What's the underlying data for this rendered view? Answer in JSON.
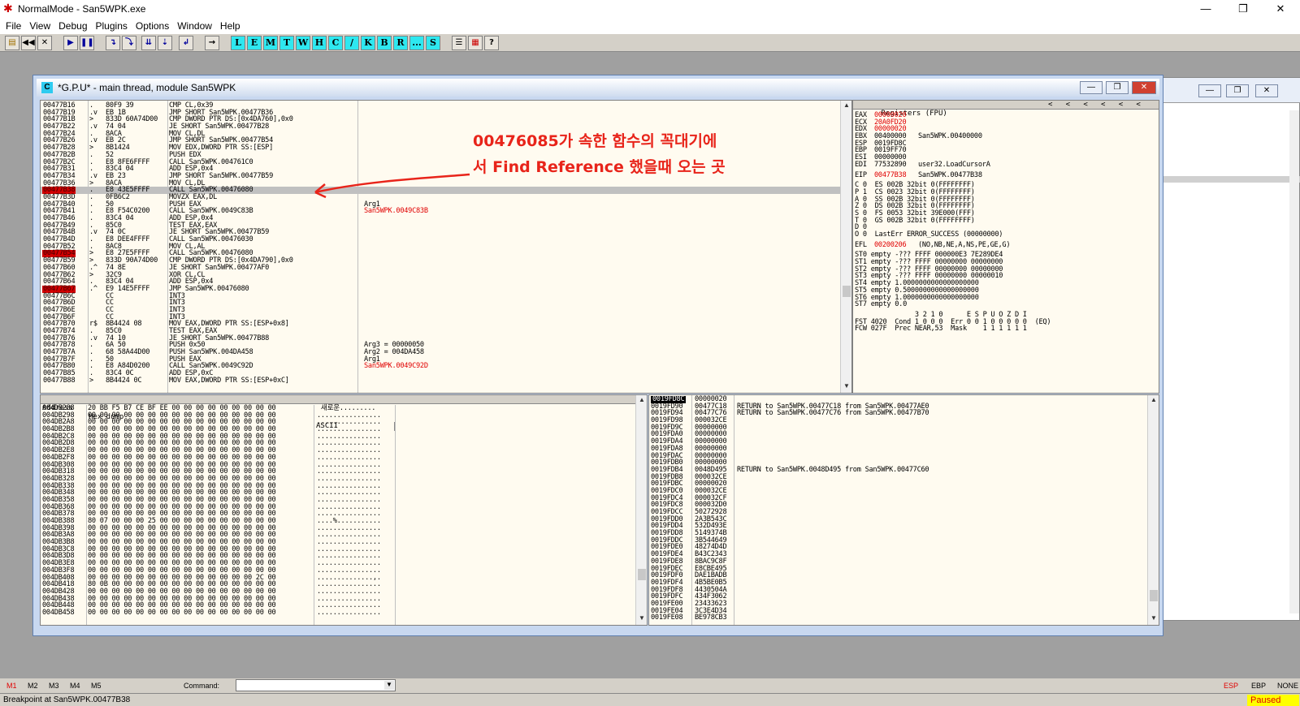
{
  "window": {
    "title": "NormalMode - San5WPK.exe",
    "minimize": "—",
    "maximize": "❐",
    "close": "✕"
  },
  "menu": [
    "File",
    "View",
    "Debug",
    "Plugins",
    "Options",
    "Window",
    "Help"
  ],
  "toolbar": {
    "tools": [
      "L",
      "E",
      "M",
      "T",
      "W",
      "H",
      "C",
      "/",
      "K",
      "B",
      "R",
      "...",
      "S"
    ]
  },
  "cpu": {
    "title": "*G.P.U* - main thread, module San5WPK"
  },
  "disasm": {
    "rows": [
      {
        "a": "00477B16",
        "m": ".",
        "h": "80F9 39",
        "i": "CMP CL,0x39",
        "c": ""
      },
      {
        "a": "00477B19",
        "m": ".v",
        "h": "EB 1B",
        "i": "JMP SHORT San5WPK.00477B36",
        "c": ""
      },
      {
        "a": "00477B1B",
        "m": ">",
        "h": "833D 60A74D00",
        "i": "CMP DWORD PTR DS:[0x4DA760],0x0",
        "c": ""
      },
      {
        "a": "00477B22",
        "m": ".v",
        "h": "74 04",
        "i": "JE SHORT San5WPK.00477B28",
        "c": ""
      },
      {
        "a": "00477B24",
        "m": ".",
        "h": "8ACA",
        "i": "MOV CL,DL",
        "c": ""
      },
      {
        "a": "00477B26",
        "m": ".v",
        "h": "EB 2C",
        "i": "JMP SHORT San5WPK.00477B54",
        "c": ""
      },
      {
        "a": "00477B28",
        "m": ">",
        "h": "8B1424",
        "i": "MOV EDX,DWORD PTR SS:[ESP]",
        "c": ""
      },
      {
        "a": "00477B2B",
        "m": ".",
        "h": "52",
        "i": "PUSH EDX",
        "c": ""
      },
      {
        "a": "00477B2C",
        "m": ".",
        "h": "E8 8FE6FFFF",
        "i": "CALL San5WPK.004761C0",
        "c": ""
      },
      {
        "a": "00477B31",
        "m": ".",
        "h": "83C4 04",
        "i": "ADD ESP,0x4",
        "c": ""
      },
      {
        "a": "00477B34",
        "m": ".v",
        "h": "EB 23",
        "i": "JMP SHORT San5WPK.00477B59",
        "c": ""
      },
      {
        "a": "00477B36",
        "m": ">",
        "h": "8ACA",
        "i": "MOV CL,DL",
        "c": ""
      },
      {
        "a": "00477B38",
        "m": ".",
        "h": "E8 43E5FFFF",
        "i": "CALL San5WPK.00476080",
        "c": "",
        "bp": true,
        "hl": true
      },
      {
        "a": "00477B3D",
        "m": ".",
        "h": "0FB6C2",
        "i": "MOVZX EAX,DL",
        "c": ""
      },
      {
        "a": "00477B40",
        "m": ".",
        "h": "50",
        "i": "PUSH EAX",
        "c": "Arg1"
      },
      {
        "a": "00477B41",
        "m": ".",
        "h": "E8 F54C0200",
        "i": "CALL San5WPK.0049C83B",
        "c": "San5WPK.0049C83B",
        "cr": true
      },
      {
        "a": "00477B46",
        "m": ".",
        "h": "83C4 04",
        "i": "ADD ESP,0x4",
        "c": ""
      },
      {
        "a": "00477B49",
        "m": ".",
        "h": "85C0",
        "i": "TEST EAX,EAX",
        "c": ""
      },
      {
        "a": "00477B4B",
        "m": ".v",
        "h": "74 0C",
        "i": "JE SHORT San5WPK.00477B59",
        "c": ""
      },
      {
        "a": "00477B4D",
        "m": ".",
        "h": "E8 DEE4FFFF",
        "i": "CALL San5WPK.00476030",
        "c": ""
      },
      {
        "a": "00477B52",
        "m": ".",
        "h": "8AC8",
        "i": "MOV CL,AL",
        "c": ""
      },
      {
        "a": "00477B54",
        "m": ">",
        "h": "E8 27E5FFFF",
        "i": "CALL San5WPK.00476080",
        "c": "",
        "bp": true
      },
      {
        "a": "00477B59",
        "m": ">",
        "h": "833D 90A74D00",
        "i": "CMP DWORD PTR DS:[0x4DA790],0x0",
        "c": ""
      },
      {
        "a": "00477B60",
        "m": ".^",
        "h": "74 8E",
        "i": "JE SHORT San5WPK.00477AF0",
        "c": ""
      },
      {
        "a": "00477B62",
        "m": ">",
        "h": "32C9",
        "i": "XOR CL,CL",
        "c": ""
      },
      {
        "a": "00477B64",
        "m": ".",
        "h": "83C4 04",
        "i": "ADD ESP,0x4",
        "c": ""
      },
      {
        "a": "00477B67",
        "m": ".^",
        "h": "E9 14E5FFFF",
        "i": "JMP San5WPK.00476080",
        "c": "",
        "bp": true
      },
      {
        "a": "00477B6C",
        "m": "",
        "h": "CC",
        "i": "INT3",
        "c": ""
      },
      {
        "a": "00477B6D",
        "m": "",
        "h": "CC",
        "i": "INT3",
        "c": ""
      },
      {
        "a": "00477B6E",
        "m": "",
        "h": "CC",
        "i": "INT3",
        "c": ""
      },
      {
        "a": "00477B6F",
        "m": "",
        "h": "CC",
        "i": "INT3",
        "c": ""
      },
      {
        "a": "00477B70",
        "m": "r$",
        "h": "8B4424 08",
        "i": "MOV EAX,DWORD PTR SS:[ESP+0x8]",
        "c": ""
      },
      {
        "a": "00477B74",
        "m": ".",
        "h": "85C0",
        "i": "TEST EAX,EAX",
        "c": ""
      },
      {
        "a": "00477B76",
        "m": ".v",
        "h": "74 10",
        "i": "JE SHORT San5WPK.00477B88",
        "c": ""
      },
      {
        "a": "00477B78",
        "m": ".",
        "h": "6A 50",
        "i": "PUSH 0x50",
        "c": "Arg3 = 00000050"
      },
      {
        "a": "00477B7A",
        "m": ".",
        "h": "68 58A44D00",
        "i": "PUSH San5WPK.004DA458",
        "c": "Arg2 = 004DA458"
      },
      {
        "a": "00477B7F",
        "m": ".",
        "h": "50",
        "i": "PUSH EAX",
        "c": "Arg1"
      },
      {
        "a": "00477B80",
        "m": ".",
        "h": "E8 A84D0200",
        "i": "CALL San5WPK.0049C92D",
        "c": "San5WPK.0049C92D",
        "cr": true
      },
      {
        "a": "00477B85",
        "m": ".",
        "h": "83C4 0C",
        "i": "ADD ESP,0xC",
        "c": ""
      },
      {
        "a": "00477B88",
        "m": ">",
        "h": "8B4424 0C",
        "i": "MOV EAX,DWORD PTR SS:[ESP+0xC]",
        "c": ""
      }
    ]
  },
  "annotation": {
    "line1": "00476085가 속한 함수의 꼭대기에",
    "line2": "서 Find Reference 했을때 오는 곳"
  },
  "registers": {
    "header": "Registers (FPU)",
    "gp": [
      {
        "n": "EAX",
        "v": "00000020",
        "c": "",
        "r": true
      },
      {
        "n": "ECX",
        "v": "20A0FD20",
        "c": "",
        "r": true
      },
      {
        "n": "EDX",
        "v": "00000020",
        "c": "",
        "r": true
      },
      {
        "n": "EBX",
        "v": "00400000",
        "c": "San5WPK.00400000"
      },
      {
        "n": "ESP",
        "v": "0019FD8C",
        "c": ""
      },
      {
        "n": "EBP",
        "v": "0019FF70",
        "c": ""
      },
      {
        "n": "ESI",
        "v": "00000000",
        "c": ""
      },
      {
        "n": "EDI",
        "v": "77532890",
        "c": "user32.LoadCursorA"
      }
    ],
    "eip": {
      "n": "EIP",
      "v": "00477B38",
      "c": "San5WPK.00477B38"
    },
    "flags": [
      "C 0  ES 002B 32bit 0(FFFFFFFF)",
      "P 1  CS 0023 32bit 0(FFFFFFFF)",
      "A 0  SS 002B 32bit 0(FFFFFFFF)",
      "Z 0  DS 002B 32bit 0(FFFFFFFF)",
      "S 0  FS 0053 32bit 39E000(FFF)",
      "T 0  GS 002B 32bit 0(FFFFFFFF)",
      "D 0",
      "O 0  LastErr ERROR_SUCCESS (00000000)"
    ],
    "efl": {
      "n": "EFL",
      "v": "00200206",
      "c": "(NO,NB,NE,A,NS,PE,GE,G)"
    },
    "fpu": [
      "ST0 empty -??? FFFF 000000E3 7E289DE4",
      "ST1 empty -??? FFFF 00000000 00000000",
      "ST2 empty -??? FFFF 00000000 00000000",
      "ST3 empty -??? FFFF 00000000 00000010",
      "ST4 empty 1.0000000000000000000",
      "ST5 empty 0.5000000000000000000",
      "ST6 empty 1.0000000000000000000",
      "ST7 empty 0.0"
    ],
    "fst": [
      "               3 2 1 0      E S P U O Z D I",
      "FST 4020  Cond 1 0 0 0  Err 0 0 1 0 0 0 0 0  (EQ)",
      "FCW 027F  Prec NEAR,53  Mask    1 1 1 1 1 1"
    ]
  },
  "dump": {
    "col_address": "Address",
    "col_hex": "Hex dump",
    "col_ascii": "ASCII",
    "rows": [
      {
        "a": "004DB288",
        "h": "20 BB F5 B7 CE BF EE 00 00 00 00 00 00 00 00 00",
        "s": " 새로운........."
      },
      {
        "a": "004DB298",
        "h": "00 00 00 00 00 00 00 00 00 00 00 00 00 00 00 00",
        "s": "................"
      },
      {
        "a": "004DB2A8",
        "h": "00 00 00 00 00 00 00 00 00 00 00 00 00 00 00 00",
        "s": "................"
      },
      {
        "a": "004DB2B8",
        "h": "00 00 00 00 00 00 00 00 00 00 00 00 00 00 00 00",
        "s": "................"
      },
      {
        "a": "004DB2C8",
        "h": "00 00 00 00 00 00 00 00 00 00 00 00 00 00 00 00",
        "s": "................"
      },
      {
        "a": "004DB2D8",
        "h": "00 00 00 00 00 00 00 00 00 00 00 00 00 00 00 00",
        "s": "................"
      },
      {
        "a": "004DB2E8",
        "h": "00 00 00 00 00 00 00 00 00 00 00 00 00 00 00 00",
        "s": "................"
      },
      {
        "a": "004DB2F8",
        "h": "00 00 00 00 00 00 00 00 00 00 00 00 00 00 00 00",
        "s": "................"
      },
      {
        "a": "004DB308",
        "h": "00 00 00 00 00 00 00 00 00 00 00 00 00 00 00 00",
        "s": "................"
      },
      {
        "a": "004DB318",
        "h": "00 00 00 00 00 00 00 00 00 00 00 00 00 00 00 00",
        "s": "................"
      },
      {
        "a": "004DB328",
        "h": "00 00 00 00 00 00 00 00 00 00 00 00 00 00 00 00",
        "s": "................"
      },
      {
        "a": "004DB338",
        "h": "00 00 00 00 00 00 00 00 00 00 00 00 00 00 00 00",
        "s": "................"
      },
      {
        "a": "004DB348",
        "h": "00 00 00 00 00 00 00 00 00 00 00 00 00 00 00 00",
        "s": "................"
      },
      {
        "a": "004DB358",
        "h": "00 00 00 00 00 00 00 00 00 00 00 00 00 00 00 00",
        "s": "................"
      },
      {
        "a": "004DB368",
        "h": "00 00 00 00 00 00 00 00 00 00 00 00 00 00 00 00",
        "s": "................"
      },
      {
        "a": "004DB378",
        "h": "00 00 00 00 00 00 00 00 00 00 00 00 00 00 00 00",
        "s": "................"
      },
      {
        "a": "004DB388",
        "h": "80 07 00 00 00 25 00 00 00 00 00 00 00 00 00 00",
        "s": "....%..........."
      },
      {
        "a": "004DB398",
        "h": "00 00 00 00 00 00 00 00 00 00 00 00 00 00 00 00",
        "s": "................"
      },
      {
        "a": "004DB3A8",
        "h": "00 00 00 00 00 00 00 00 00 00 00 00 00 00 00 00",
        "s": "................"
      },
      {
        "a": "004DB3B8",
        "h": "00 00 00 00 00 00 00 00 00 00 00 00 00 00 00 00",
        "s": "................"
      },
      {
        "a": "004DB3C8",
        "h": "00 00 00 00 00 00 00 00 00 00 00 00 00 00 00 00",
        "s": "................"
      },
      {
        "a": "004DB3D8",
        "h": "00 00 00 00 00 00 00 00 00 00 00 00 00 00 00 00",
        "s": "................"
      },
      {
        "a": "004DB3E8",
        "h": "00 00 00 00 00 00 00 00 00 00 00 00 00 00 00 00",
        "s": "................"
      },
      {
        "a": "004DB3F8",
        "h": "00 00 00 00 00 00 00 00 00 00 00 00 00 00 00 00",
        "s": "................"
      },
      {
        "a": "004DB408",
        "h": "00 00 00 00 00 00 00 00 00 00 00 00 00 00 2C 00",
        "s": "..............,."
      },
      {
        "a": "004DB418",
        "h": "80 0B 00 00 00 00 00 00 00 00 00 00 00 00 00 00",
        "s": "................"
      },
      {
        "a": "004DB428",
        "h": "00 00 00 00 00 00 00 00 00 00 00 00 00 00 00 00",
        "s": "................"
      },
      {
        "a": "004DB438",
        "h": "00 00 00 00 00 00 00 00 00 00 00 00 00 00 00 00",
        "s": "................"
      },
      {
        "a": "004DB448",
        "h": "00 00 00 00 00 00 00 00 00 00 00 00 00 00 00 00",
        "s": "................"
      },
      {
        "a": "004DB458",
        "h": "00 00 00 00 00 00 00 00 00 00 00 00 00 00 00 00",
        "s": "................"
      }
    ]
  },
  "stack": {
    "rows": [
      {
        "a": "0019FD8C",
        "v": "00000020",
        "c": "",
        "sel": true
      },
      {
        "a": "0019FD90",
        "v": "00477C18",
        "c": "RETURN to San5WPK.00477C18 from San5WPK.00477AE0"
      },
      {
        "a": "0019FD94",
        "v": "00477C76",
        "c": "RETURN to San5WPK.00477C76 from San5WPK.00477B70"
      },
      {
        "a": "0019FD98",
        "v": "000032CE",
        "c": ""
      },
      {
        "a": "0019FD9C",
        "v": "00000000",
        "c": ""
      },
      {
        "a": "0019FDA0",
        "v": "00000000",
        "c": ""
      },
      {
        "a": "0019FDA4",
        "v": "00000000",
        "c": ""
      },
      {
        "a": "0019FDA8",
        "v": "00000000",
        "c": ""
      },
      {
        "a": "0019FDAC",
        "v": "00000000",
        "c": ""
      },
      {
        "a": "0019FDB0",
        "v": "00000000",
        "c": ""
      },
      {
        "a": "0019FDB4",
        "v": "0048D495",
        "c": "RETURN to San5WPK.0048D495 from San5WPK.00477C60"
      },
      {
        "a": "0019FDB8",
        "v": "000032CE",
        "c": ""
      },
      {
        "a": "0019FDBC",
        "v": "00000020",
        "c": ""
      },
      {
        "a": "0019FDC0",
        "v": "000032CE",
        "c": ""
      },
      {
        "a": "0019FDC4",
        "v": "000032CF",
        "c": ""
      },
      {
        "a": "0019FDC8",
        "v": "000032D0",
        "c": ""
      },
      {
        "a": "0019FDCC",
        "v": "50272928",
        "c": ""
      },
      {
        "a": "0019FDD0",
        "v": "2A3B543C",
        "c": ""
      },
      {
        "a": "0019FDD4",
        "v": "532D493E",
        "c": ""
      },
      {
        "a": "0019FDD8",
        "v": "5149374B",
        "c": ""
      },
      {
        "a": "0019FDDC",
        "v": "3B544649",
        "c": ""
      },
      {
        "a": "0019FDE0",
        "v": "48274D4D",
        "c": ""
      },
      {
        "a": "0019FDE4",
        "v": "B43C2343",
        "c": ""
      },
      {
        "a": "0019FDE8",
        "v": "8BAC9C8F",
        "c": ""
      },
      {
        "a": "0019FDEC",
        "v": "E8CBE495",
        "c": ""
      },
      {
        "a": "0019FDF0",
        "v": "DAE1BADB",
        "c": ""
      },
      {
        "a": "0019FDF4",
        "v": "4B5BE0B5",
        "c": ""
      },
      {
        "a": "0019FDF8",
        "v": "4430504A",
        "c": ""
      },
      {
        "a": "0019FDFC",
        "v": "434F3062",
        "c": ""
      },
      {
        "a": "0019FE00",
        "v": "23433623",
        "c": ""
      },
      {
        "a": "0019FE04",
        "v": "3C3E4D34",
        "c": ""
      },
      {
        "a": "0019FE08",
        "v": "BE978CB3",
        "c": ""
      }
    ]
  },
  "command": {
    "marks": [
      "M1",
      "M2",
      "M3",
      "M4",
      "M5"
    ],
    "label": "Command:",
    "value": "",
    "right": [
      "ESP",
      "EBP",
      "NONE"
    ]
  },
  "status": {
    "text": "Breakpoint at San5WPK.00477B38",
    "state": "Paused"
  }
}
